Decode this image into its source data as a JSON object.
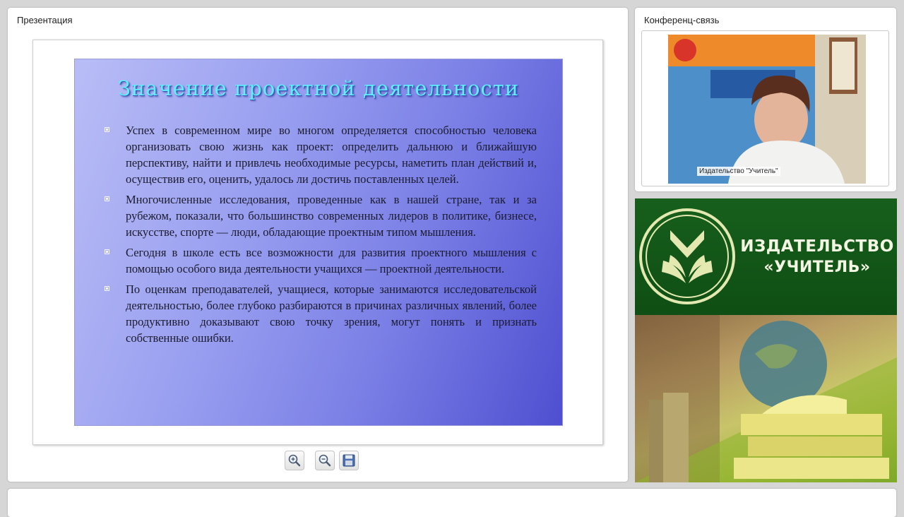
{
  "presentation": {
    "panel_title": "Презентация",
    "slide": {
      "title": "Значение проектной деятельности",
      "bullets": [
        "Успех в современном мире во многом определяется способностью человека организовать свою жизнь как проект: определить дальнюю и ближайшую перспективу, найти и привлечь необходимые ресурсы, наметить план действий и, осуществив его, оценить, удалось ли достичь поставленных целей.",
        "Многочисленные исследования, проведенные как в нашей стране, так и за рубежом, показали, что большинство современных лидеров в политике, бизнесе, искусстве, спорте — люди, обладающие проектным типом мышления.",
        "Сегодня в школе есть все возможности для развития проектного мышления с помощью особого вида деятельности учащихся — проектной деятельности.",
        "По оценкам преподавателей, учащиеся, которые занимаются исследовательской деятельностью, более глубоко разбираются в причинах различных явлений, более продуктивно доказывают свою точку зрения, могут понять и признать собственные ошибки."
      ]
    },
    "toolbar": {
      "zoom_in_icon": "zoom-in-icon",
      "zoom_out_icon": "zoom-out-icon",
      "save_icon": "floppy-disk-icon"
    }
  },
  "conference": {
    "panel_title": "Конференц-связь",
    "participant_name": "Издательство \"Учитель\""
  },
  "banner": {
    "line1": "ИЗДАТЕЛЬСТВО",
    "line2": "«УЧИТЕЛЬ»"
  },
  "colors": {
    "slide_title": "#5ef0ff",
    "banner_green": "#175f1c",
    "slide_gradient_end": "#4e4fd0"
  }
}
